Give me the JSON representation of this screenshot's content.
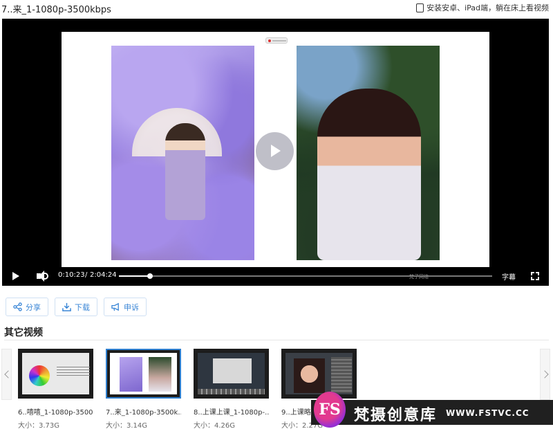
{
  "header": {
    "video_title": "7..来_1-1080p-3500kbps",
    "ipad_link": "安装安卓、iPad端，躺在床上看视频"
  },
  "player": {
    "current_time": "0:10:23",
    "separator": "/",
    "duration": "2:04:24",
    "progress_fraction": 0.083,
    "subtitle_label": "字幕",
    "watermark": "梵子网络"
  },
  "actions": {
    "share": "分享",
    "download": "下载",
    "report": "申诉"
  },
  "other_videos": {
    "title": "其它视频",
    "items": [
      {
        "name": "6..嘻嘻_1-1080p-3500...",
        "size": "大小：3.73G"
      },
      {
        "name": "7..来_1-1080p-3500k...",
        "size": "大小：3.14G"
      },
      {
        "name": "8..上课上课_1-1080p-...",
        "size": "大小：4.26G"
      },
      {
        "name": "9..上课略",
        "size": "大小：2.27G"
      }
    ]
  },
  "brand": {
    "logo_text": "FS",
    "name": "梵摄创意库",
    "url": "WWW.FSTVC.CC"
  },
  "colors": {
    "accent": "#3a86d6",
    "active_border": "#2f7fcf",
    "player_bg": "#000000"
  }
}
